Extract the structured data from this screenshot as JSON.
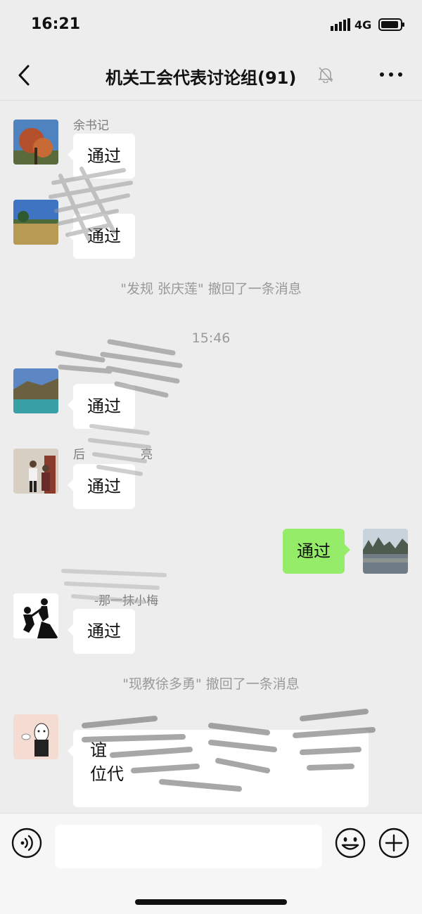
{
  "status_bar": {
    "time": "16:21",
    "network": "4G"
  },
  "header": {
    "title": "机关工会代表讨论组(91)"
  },
  "messages": [
    {
      "sender": "余书记",
      "text": "通过"
    },
    {
      "sender": "",
      "text": "通过"
    },
    {
      "system": "\"发规 张庆莲\" 撤回了一条消息"
    },
    {
      "timestamp": "15:46"
    },
    {
      "sender": "",
      "text": "通过"
    },
    {
      "sender": "后",
      "sender_tail": "亮",
      "text": "通过"
    },
    {
      "mine": true,
      "text": "通过"
    },
    {
      "sender": "-那一抹小梅",
      "text": "通过"
    },
    {
      "system": "\"现教徐多勇\" 撤回了一条消息"
    },
    {
      "sender": "",
      "text": "谊",
      "text_line2": "位代"
    }
  ],
  "icons": {
    "back": "chevron-left-icon",
    "mute": "bell-off-icon",
    "more": "more-dots-icon",
    "voice": "voice-icon",
    "emoji": "emoji-icon",
    "plus": "plus-icon"
  },
  "colors": {
    "background": "#ededed",
    "my_bubble": "#95ec69",
    "other_bubble": "#ffffff"
  }
}
